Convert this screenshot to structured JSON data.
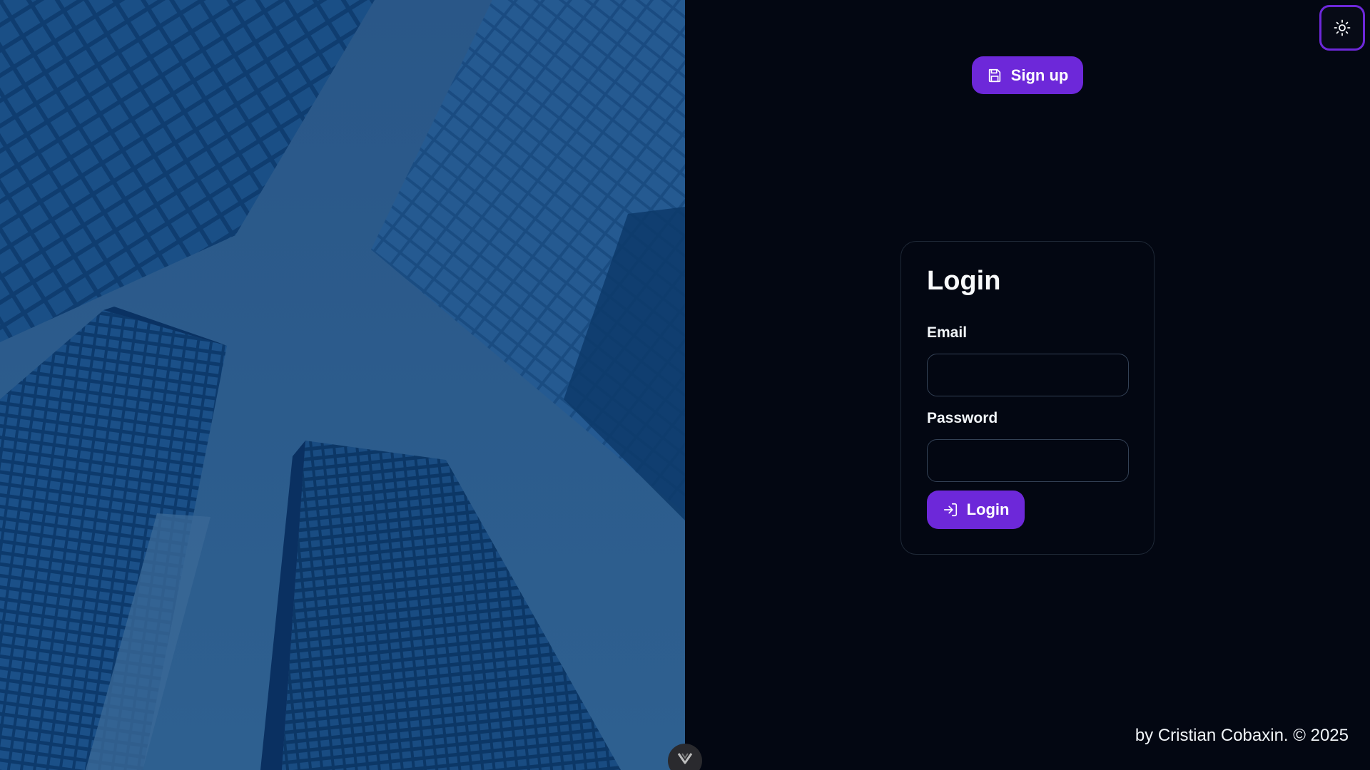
{
  "header": {
    "signup_label": "Sign up",
    "theme_toggle_icon": "sun-icon",
    "signup_icon": "save-icon"
  },
  "login_card": {
    "title": "Login",
    "email_label": "Email",
    "email_value": "",
    "email_placeholder": "",
    "password_label": "Password",
    "password_value": "",
    "password_placeholder": "",
    "submit_label": "Login",
    "submit_icon": "log-in-icon"
  },
  "footer": {
    "credit": "by Cristian Cobaxin. © 2025"
  },
  "hero": {
    "image": "skyscrapers-looking-up",
    "tint": "#2c5a8a"
  },
  "colors": {
    "accent": "#6d28d9",
    "background": "#030712",
    "card_border": "#1f2937",
    "input_border": "#334155",
    "text": "#f8fafc"
  }
}
